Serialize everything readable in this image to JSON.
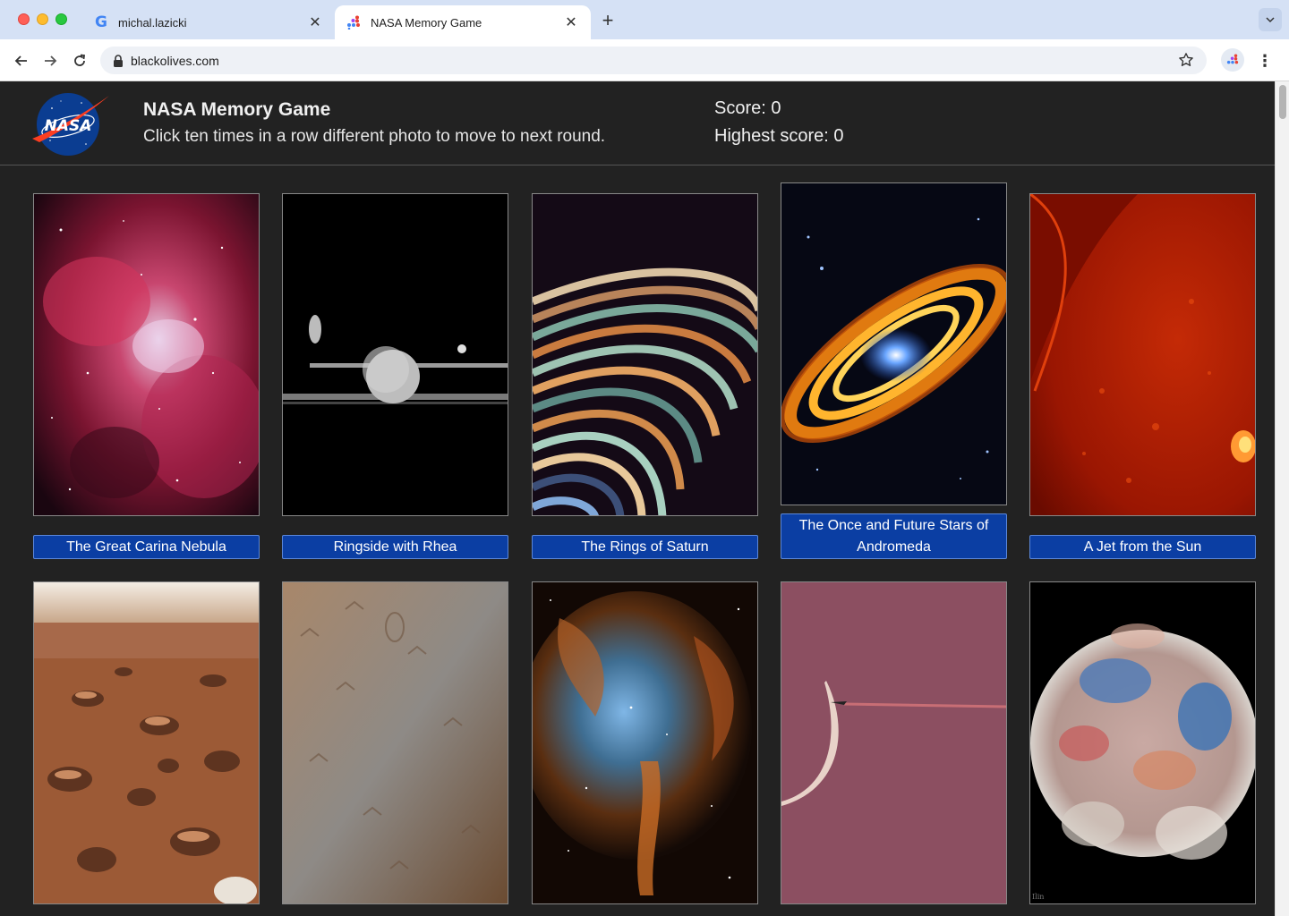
{
  "browser": {
    "tabs": [
      {
        "title": "michal.lazicki",
        "favicon": "google-g-icon",
        "active": false
      },
      {
        "title": "NASA Memory Game",
        "favicon": "colorful-dots-icon",
        "active": true
      }
    ],
    "url": "blackolives.com",
    "icons": {
      "back": "back-arrow-icon",
      "forward": "forward-arrow-icon",
      "reload": "reload-icon",
      "bookmark": "star-icon",
      "menu": "kebab-menu-icon"
    }
  },
  "header": {
    "logo": "nasa-logo",
    "title": "NASA Memory Game",
    "subtitle": "Click ten times in a row different photo to move to next round.",
    "score": "Score: 0",
    "highest_score": "Highest score: 0",
    "logo_text": "NASA"
  },
  "cards": [
    {
      "caption": "The Great Carina Nebula"
    },
    {
      "caption": "Ringside with Rhea"
    },
    {
      "caption": "The Rings of Saturn"
    },
    {
      "caption": "The Once and Future Stars of Andromeda"
    },
    {
      "caption": "A Jet from the Sun"
    },
    {
      "caption": ""
    },
    {
      "caption": ""
    },
    {
      "caption": ""
    },
    {
      "caption": ""
    },
    {
      "caption": ""
    }
  ],
  "colors": {
    "page_bg": "#222222",
    "caption_bg": "#0b3ea3",
    "tab_strip": "#d5e1f5"
  }
}
